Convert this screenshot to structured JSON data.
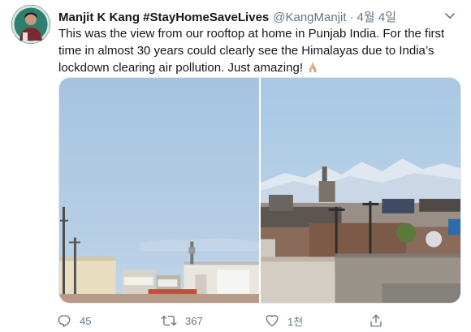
{
  "tweet": {
    "display_name": "Manjit K Kang #StayHomeSaveLives",
    "handle": "@KangManjit",
    "separator": "·",
    "timestamp": "4월 4일",
    "text": "This was the view from our rooftop at home in Punjab India. For the first time in almost 30 years could clearly see the Himalayas due to India’s lockdown clearing air pollution. Just amazing!",
    "emoji": "folded-hands-emoji"
  },
  "actions": {
    "reply_count": "45",
    "retweet_count": "367",
    "like_count": "1천"
  },
  "colors": {
    "secondary_text": "#657786",
    "sky_left": "#a9c6e2",
    "sky_right": "#aecde6"
  }
}
